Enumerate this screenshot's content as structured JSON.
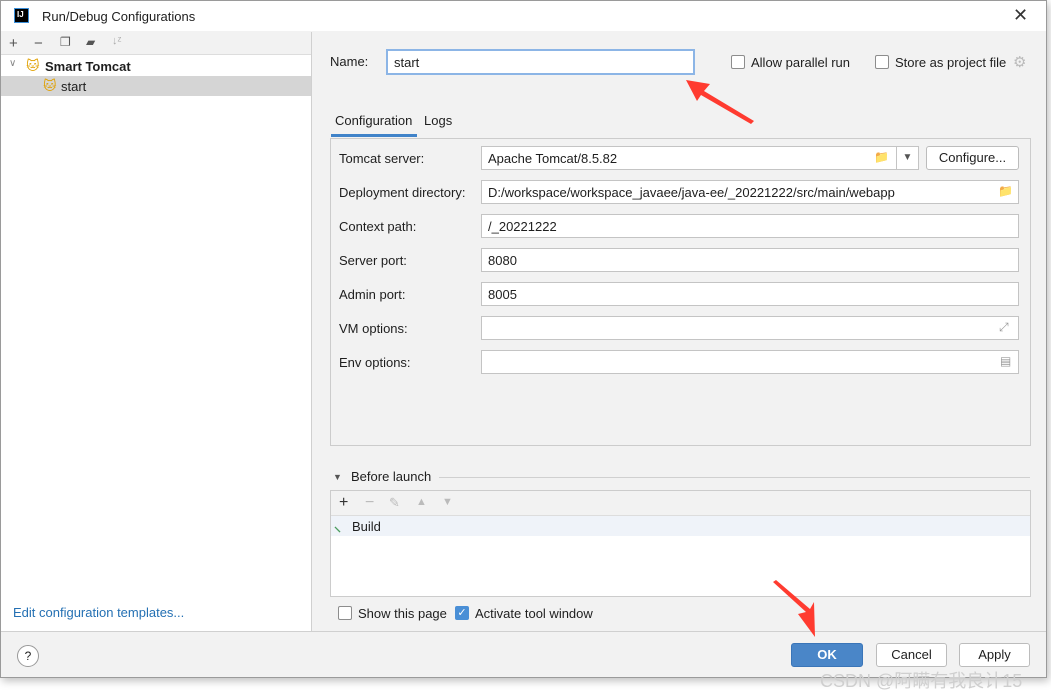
{
  "window": {
    "title": "Run/Debug Configurations",
    "logo": "IJ"
  },
  "sidebar": {
    "toolbar": [
      "add-icon",
      "remove-icon",
      "copy-icon",
      "new-folder-icon",
      "sort-icon"
    ],
    "tree": {
      "group": "Smart Tomcat",
      "items": [
        {
          "label": "start",
          "selected": true
        }
      ]
    },
    "footer_link": "Edit configuration templates..."
  },
  "main": {
    "name_label": "Name:",
    "name_value": "start",
    "allow_parallel": {
      "label": "Allow parallel run",
      "checked": false
    },
    "store_project": {
      "label": "Store as project file",
      "checked": false
    },
    "tabs": [
      {
        "label": "Configuration",
        "active": true
      },
      {
        "label": "Logs",
        "active": false
      }
    ],
    "fields": [
      {
        "label": "Tomcat server:",
        "value": "Apache Tomcat/8.5.82"
      },
      {
        "label": "Deployment directory:",
        "value": "D:/workspace/workspace_javaee/java-ee/_20221222/src/main/webapp"
      },
      {
        "label": "Context path:",
        "value": "/_20221222"
      },
      {
        "label": "Server port:",
        "value": "8080"
      },
      {
        "label": "Admin port:",
        "value": "8005"
      },
      {
        "label": "VM options:",
        "value": ""
      },
      {
        "label": "Env options:",
        "value": ""
      }
    ],
    "configure_button": "Configure...",
    "before_launch": {
      "title": "Before launch",
      "items": [
        "Build"
      ]
    },
    "show_page": {
      "label": "Show this page",
      "checked": false
    },
    "activate_tool": {
      "label": "Activate tool window",
      "checked": true
    }
  },
  "buttons": {
    "ok": "OK",
    "cancel": "Cancel",
    "apply": "Apply",
    "help": "?"
  },
  "watermark": "CSDN @阿瞒有我良计15",
  "colors": {
    "accent": "#4a86c8",
    "annotation": "#ff3b30"
  }
}
